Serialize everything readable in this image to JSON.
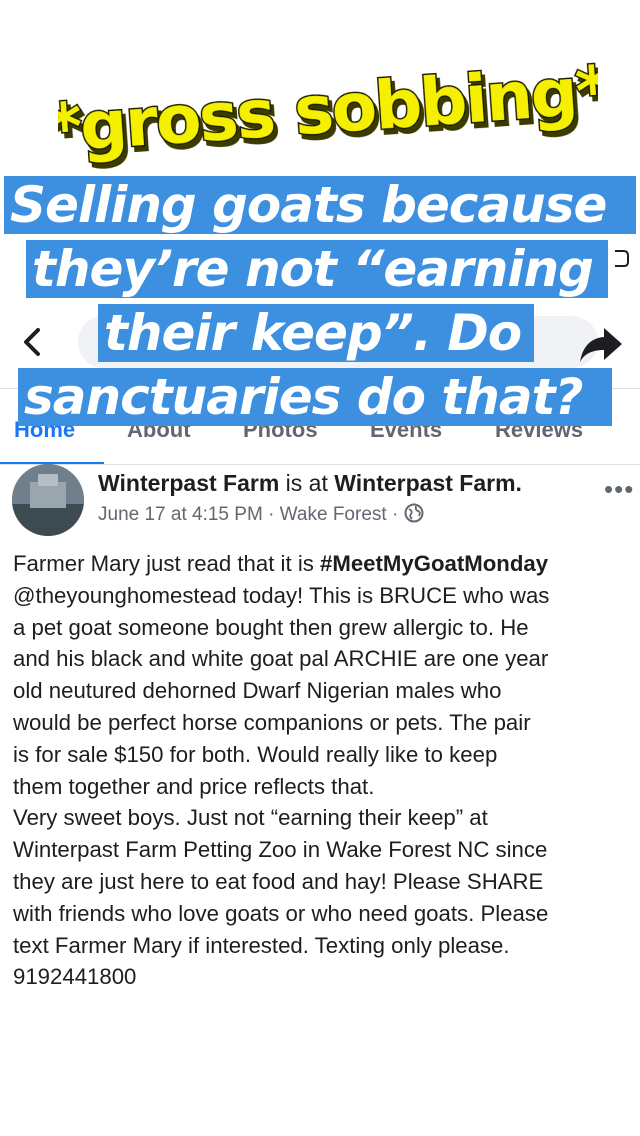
{
  "nav": {
    "tabs": [
      "Home",
      "About",
      "Photos",
      "Events",
      "Reviews"
    ],
    "active_tab": "Home"
  },
  "sticker": {
    "text": "*gross sobbing*"
  },
  "caption": {
    "lines": [
      "Selling goats because",
      "they’re not “earning",
      "their keep”. Do",
      "sanctuaries do that?"
    ]
  },
  "post": {
    "author": "Winterpast Farm",
    "is_at": "is at",
    "location": "Winterpast Farm.",
    "timestamp": "June 17 at 4:15 PM",
    "place": "Wake Forest",
    "separator": "·",
    "lines": [
      "Farmer Mary just read that it is #MeetMyGoatMonday",
      "@theyounghomestead today! This is BRUCE who was",
      "a pet goat someone bought then grew allergic to. He",
      "and his black and white goat pal ARCHIE are one year",
      "old neutured dehorned Dwarf Nigerian males who",
      "would be perfect horse companions or pets. The pair",
      "is for sale $150 for both. Would really like to keep",
      "them together and price reflects that.",
      "Very sweet boys. Just not “earning their keep” at",
      "Winterpast Farm Petting Zoo in Wake Forest NC since",
      "they are just here to eat food and hay! Please SHARE",
      "with friends who love goats or who need goats. Please",
      "text Farmer Mary if interested. Texting only please.",
      "9192441800"
    ]
  },
  "colors": {
    "caption_bg": "#3d8fe0",
    "accent": "#1877f2",
    "sticker_fill": "#f4f000"
  }
}
